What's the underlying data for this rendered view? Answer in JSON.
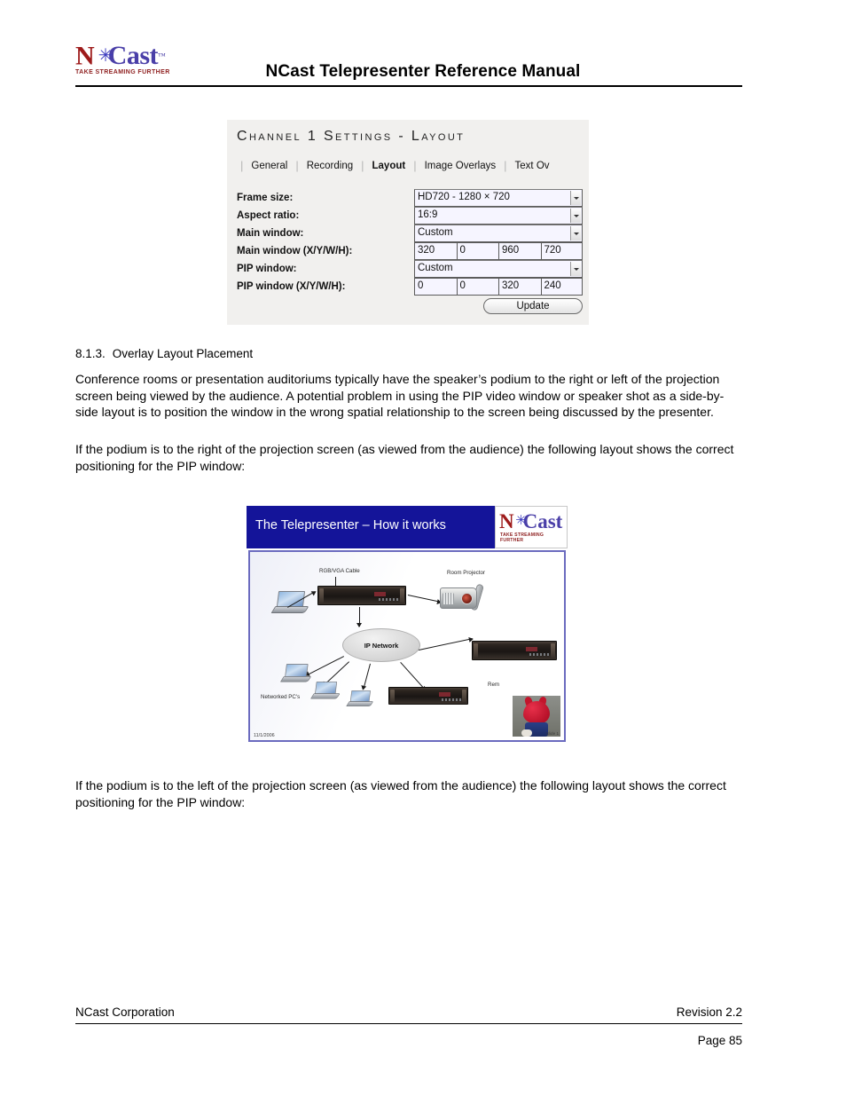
{
  "header": {
    "logo": {
      "letter_n": "N",
      "star_icon": "✳",
      "word_cast": "Cast",
      "trademark": "™",
      "tagline": "TAKE STREAMING FURTHER"
    },
    "title": "NCast Telepresenter Reference Manual"
  },
  "settings_panel": {
    "heading": "Channel 1 Settings - Layout",
    "tabs": [
      {
        "label": "General",
        "active": false
      },
      {
        "label": "Recording",
        "active": false
      },
      {
        "label": "Layout",
        "active": true
      },
      {
        "label": "Image Overlays",
        "active": false
      },
      {
        "label": "Text Ov",
        "active": false
      }
    ],
    "fields": {
      "frame_size_label": "Frame size:",
      "frame_size_value": "HD720 - 1280 × 720",
      "aspect_ratio_label": "Aspect ratio:",
      "aspect_ratio_value": "16:9",
      "main_window_label": "Main window:",
      "main_window_value": "Custom",
      "main_window_xywh_label": "Main window (X/Y/W/H):",
      "main_window_x": "320",
      "main_window_y": "0",
      "main_window_w": "960",
      "main_window_h": "720",
      "pip_window_label": "PIP window:",
      "pip_window_value": "Custom",
      "pip_window_xywh_label": "PIP window (X/Y/W/H):",
      "pip_window_x": "0",
      "pip_window_y": "0",
      "pip_window_w": "320",
      "pip_window_h": "240"
    },
    "update_button": "Update"
  },
  "content": {
    "section_number": "8.1.3.",
    "section_title": "Overlay Layout Placement",
    "paragraph_1": "Conference rooms or presentation auditoriums typically have the speaker’s podium to the right or left of the projection screen being viewed by the audience. A potential problem in using the PIP video window or speaker shot as a side-by-side layout is to position the window in the wrong spatial relationship to the screen being discussed by the presenter.",
    "paragraph_2": "If the podium is to the right of the projection screen (as viewed from the audience) the following layout shows the correct positioning for the PIP window:",
    "paragraph_3": "If the podium is to the left of the projection screen (as viewed from the audience) the following layout shows the correct positioning for the PIP window:"
  },
  "slide": {
    "title": "The Telepresenter – How it works",
    "logo": {
      "letter_n": "N",
      "star_icon": "✳",
      "word_cast": "Cast",
      "trademark": "™",
      "tagline": "TAKE STREAMING FURTHER"
    },
    "labels": {
      "rgb_vga_cable": "RGB/VGA Cable",
      "room_projector": "Room Projector",
      "ip_network": "IP Network",
      "networked_pcs": "Networked PC's",
      "remote": "Rem"
    },
    "date_stamp": "11/1/2006",
    "pip_stamp": "Slide 1"
  },
  "footer": {
    "left": "NCast Corporation",
    "right": "Revision 2.2",
    "page": "Page 85"
  },
  "colors": {
    "logo_red": "#9e1b1b",
    "logo_purple": "#4a3fa8",
    "slide_navy": "#141499",
    "slide_border": "#6b6bbf",
    "panel_bg": "#f1f0ee",
    "field_bg": "#f6f5ff"
  }
}
